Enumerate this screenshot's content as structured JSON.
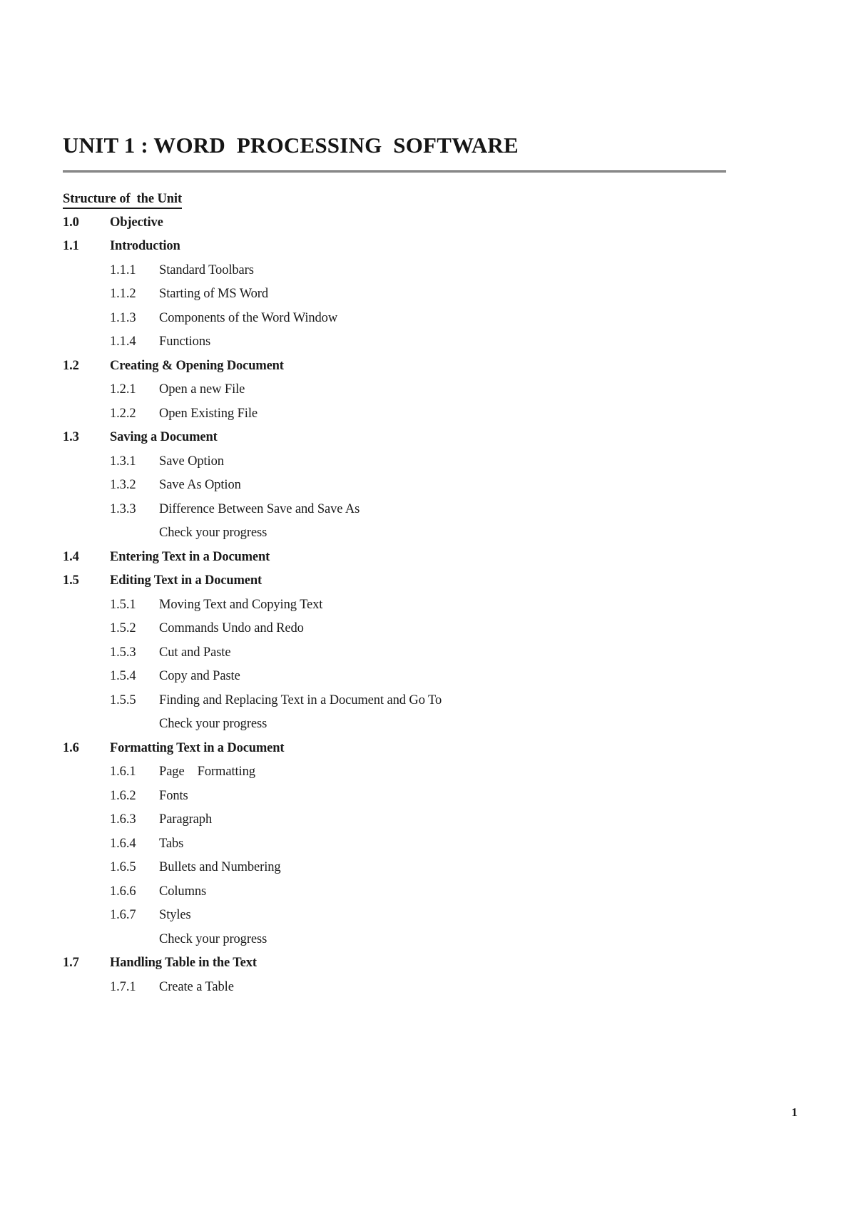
{
  "document": {
    "title": "UNIT 1 : WORD  PROCESSING  SOFTWARE",
    "structure_heading": "Structure of  the Unit",
    "page_number": "1",
    "rule_color": "#8a8a8a",
    "text_color": "#1a1a1a",
    "background_color": "#ffffff"
  },
  "toc": [
    {
      "level": 1,
      "num": "1.0",
      "label": "Objective"
    },
    {
      "level": 1,
      "num": "1.1",
      "label": "Introduction"
    },
    {
      "level": 2,
      "num": "1.1.1",
      "label": "Standard Toolbars"
    },
    {
      "level": 2,
      "num": "1.1.2",
      "label": "Starting of MS Word"
    },
    {
      "level": 2,
      "num": "1.1.3",
      "label": "Components of the Word Window"
    },
    {
      "level": 2,
      "num": "1.1.4",
      "label": "Functions"
    },
    {
      "level": 1,
      "num": "1.2",
      "label": "Creating & Opening Document"
    },
    {
      "level": 2,
      "num": "1.2.1",
      "label": "Open a new File"
    },
    {
      "level": 2,
      "num": "1.2.2",
      "label": "Open Existing File"
    },
    {
      "level": 1,
      "num": "1.3",
      "label": "Saving a Document"
    },
    {
      "level": 2,
      "num": "1.3.1",
      "label": "Save Option"
    },
    {
      "level": 2,
      "num": "1.3.2",
      "label": "Save As Option"
    },
    {
      "level": 2,
      "num": "1.3.3",
      "label": "Difference Between Save and Save As"
    },
    {
      "level": "note",
      "num": "",
      "label": "Check your progress"
    },
    {
      "level": 1,
      "num": "1.4",
      "label": "Entering Text in a Document"
    },
    {
      "level": 1,
      "num": "1.5",
      "label": "Editing Text in a Document"
    },
    {
      "level": 2,
      "num": "1.5.1",
      "label": "Moving Text and Copying Text"
    },
    {
      "level": 2,
      "num": "1.5.2",
      "label": "Commands Undo and Redo"
    },
    {
      "level": 2,
      "num": "1.5.3",
      "label": "Cut and Paste"
    },
    {
      "level": 2,
      "num": "1.5.4",
      "label": "Copy and Paste"
    },
    {
      "level": 2,
      "num": "1.5.5",
      "label": "Finding and Replacing Text in a Document and Go To"
    },
    {
      "level": "note",
      "num": "",
      "label": "Check your progress"
    },
    {
      "level": 1,
      "num": "1.6",
      "label": "Formatting Text in a Document"
    },
    {
      "level": 2,
      "num": "1.6.1",
      "label": "Page    Formatting"
    },
    {
      "level": 2,
      "num": "1.6.2",
      "label": "Fonts"
    },
    {
      "level": 2,
      "num": "1.6.3",
      "label": "Paragraph"
    },
    {
      "level": 2,
      "num": "1.6.4",
      "label": "Tabs"
    },
    {
      "level": 2,
      "num": "1.6.5",
      "label": "Bullets and Numbering"
    },
    {
      "level": 2,
      "num": "1.6.6",
      "label": "Columns"
    },
    {
      "level": 2,
      "num": "1.6.7",
      "label": "Styles"
    },
    {
      "level": "note",
      "num": "",
      "label": "Check your progress"
    },
    {
      "level": 1,
      "num": "1.7",
      "label": "Handling Table in the Text"
    },
    {
      "level": 2,
      "num": "1.7.1",
      "label": "Create a Table"
    }
  ]
}
